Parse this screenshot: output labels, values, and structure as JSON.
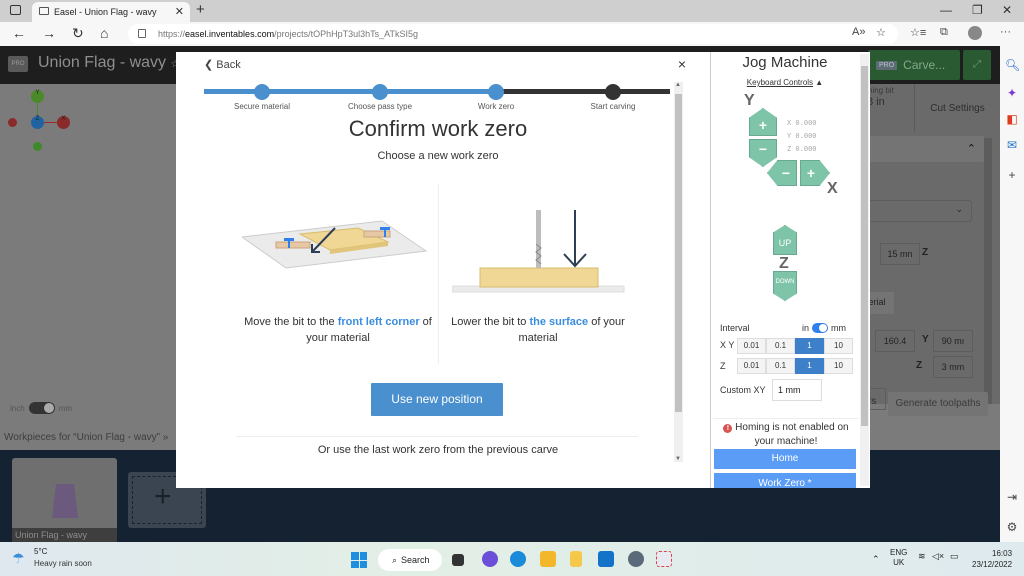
{
  "browser": {
    "tab_title": "Easel - Union Flag - wavy",
    "new_tab": "+",
    "url_prefix": "https://",
    "url_domain": "easel.inventables.com",
    "url_path": "/projects/tOPhHpT3ul3hTs_ATkSI5g",
    "window_controls": {
      "minimize": "—",
      "maximize": "❐",
      "close": "✕"
    }
  },
  "app": {
    "project_title": "Union Flag - wavy",
    "pro_badge": "PRO",
    "carve_label": "Carve...",
    "bit_label": "shing bit",
    "bit_value": "/8 in",
    "cut_settings": "Cut Settings",
    "dim_fields": {
      "depth": "15 mn",
      "x": "160.4",
      "y": "90 mı",
      "z": "3 mm"
    },
    "axis_labels": {
      "z": "Z",
      "y": "Y"
    },
    "material_btn": "erial",
    "generate_toolpaths": "Generate toolpaths",
    "rs_text": "rs",
    "units_left": "inch",
    "units_right": "mm",
    "workpieces_heading": "Workpieces for “Union Flag - wavy”",
    "workpiece_name": "Union Flag - wavy"
  },
  "modal": {
    "back_label": "Back",
    "close_label": "×",
    "steps": [
      {
        "label": "Secure material",
        "state": "done"
      },
      {
        "label": "Choose pass type",
        "state": "done"
      },
      {
        "label": "Work zero",
        "state": "current"
      },
      {
        "label": "Start carving",
        "state": "todo"
      }
    ],
    "title": "Confirm work zero",
    "subtitle": "Choose a new work zero",
    "instruction_left": {
      "pre": "Move the bit to the ",
      "highlight": "front left corner",
      "post": " of your material"
    },
    "instruction_right": {
      "pre": "Lower the bit to ",
      "highlight": "the surface",
      "post": " of your material"
    },
    "use_new_position": "Use new position",
    "last_work_zero": "Or use the last work zero from the previous carve"
  },
  "jog": {
    "title": "Jog Machine",
    "keyboard_controls": "Keyboard Controls",
    "axis_y": "Y",
    "axis_x": "X",
    "axis_z": "Z",
    "coords": {
      "x": "X 0.000",
      "y": "Y 0.000",
      "z": "Z 0.000"
    },
    "up_label": "UP",
    "down_label": "DOWN",
    "interval_label": "Interval",
    "unit_in": "in",
    "unit_mm": "mm",
    "xy_label": "X Y",
    "z_label": "Z",
    "xy_options": [
      "0.01",
      "0.1",
      "1",
      "10"
    ],
    "xy_selected": "1",
    "z_options": [
      "0.01",
      "0.1",
      "1",
      "10"
    ],
    "z_selected": "1",
    "custom_xy_label": "Custom XY",
    "custom_xy_value": "1 mm",
    "homing_warning": "Homing is not enabled on your machine!",
    "home_button": "Home",
    "work_zero_button": "Work Zero *"
  },
  "taskbar": {
    "weather_temp": "5°C",
    "weather_desc": "Heavy rain soon",
    "search_label": "Search",
    "lang_top": "ENG",
    "lang_bottom": "UK",
    "time": "16:03",
    "date": "23/12/2022"
  }
}
